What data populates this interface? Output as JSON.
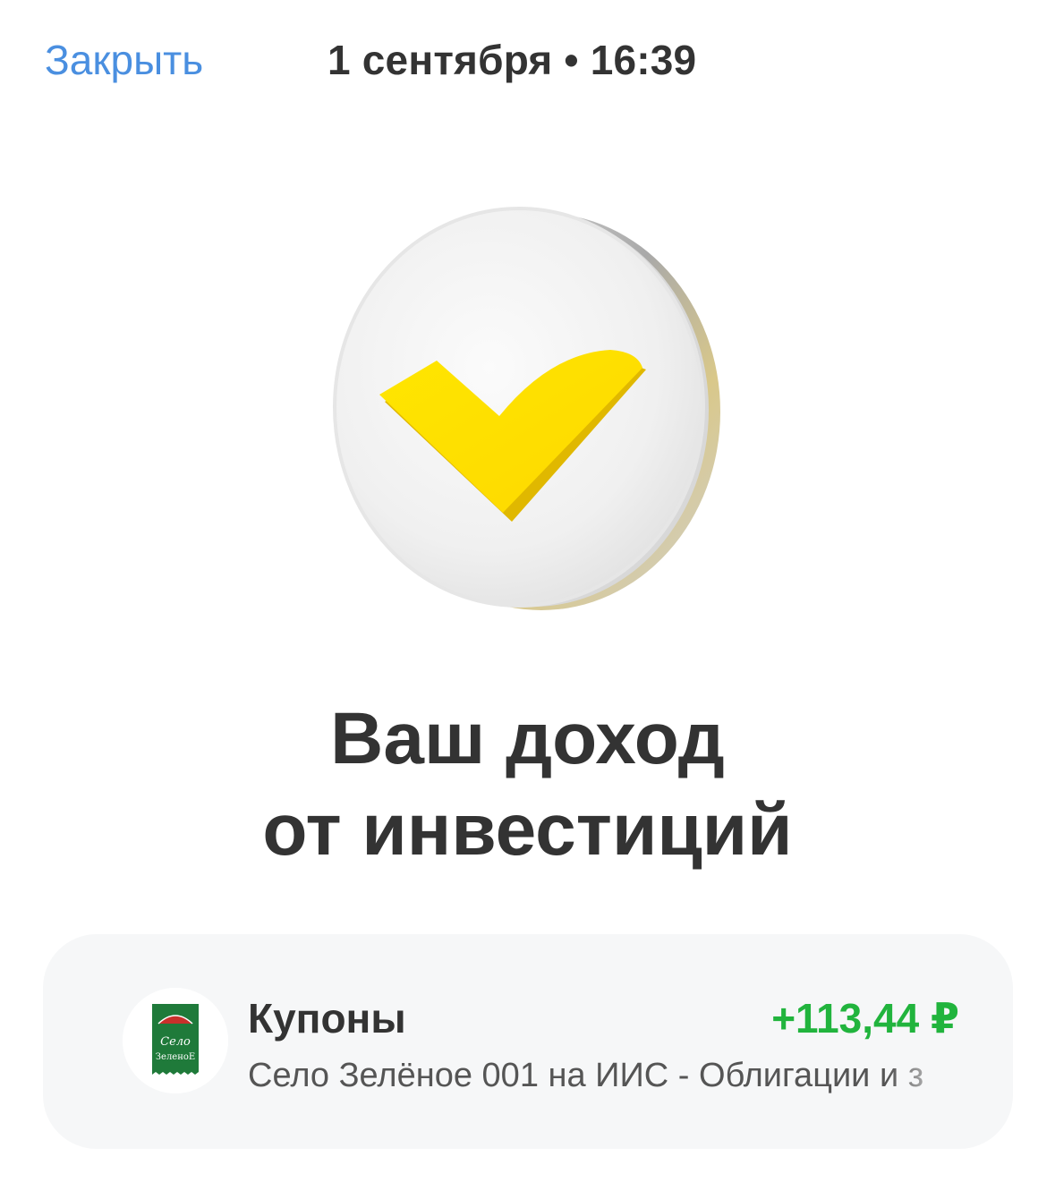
{
  "header": {
    "close_label": "Закрыть",
    "title": "1 сентября • 16:39"
  },
  "hero": {
    "icon": "checkmark-coin-icon",
    "accent_color": "#FFE000"
  },
  "headline": {
    "line1": "Ваш доход",
    "line2": "от инвестиций"
  },
  "operation": {
    "logo_text_line1": "Село",
    "logo_text_line2": "ЗеленоЕ",
    "title": "Купоны",
    "amount": "+113,44 ₽",
    "amount_color": "#21B43D",
    "subtitle": "Село Зелёное 001 на ИИС - Облигации и з"
  }
}
